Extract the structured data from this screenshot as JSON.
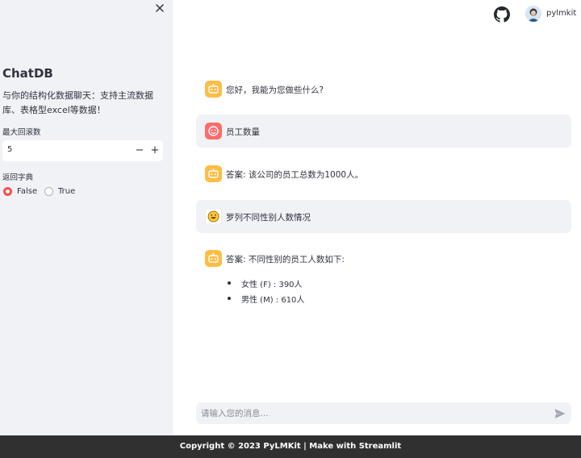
{
  "sidebar": {
    "title": "ChatDB",
    "description": "与你的结构化数据聊天：支持主流数据库、表格型excel等数据！",
    "max_rounds_label": "最大回滚数",
    "max_rounds_value": "5",
    "decrement": "−",
    "increment": "+",
    "return_dict_label": "返回字典",
    "radio_false": "False",
    "radio_true": "True"
  },
  "header": {
    "username": "pylmkit"
  },
  "messages": [
    {
      "role": "assistant",
      "text": "您好，我能为您做些什么?"
    },
    {
      "role": "user",
      "text": "员工数量"
    },
    {
      "role": "assistant",
      "text": "答案: 该公司的员工总数为1000人。"
    },
    {
      "role": "user",
      "text": "罗列不同性别人数情况"
    },
    {
      "role": "assistant",
      "text": "答案: 不同性别的员工人数如下:",
      "list": [
        "女性 (F) : 390人",
        "男性 (M) : 610人"
      ]
    }
  ],
  "chat_input": {
    "placeholder": "请输入您的消息..."
  },
  "footer": {
    "text": "Copyright © 2023 PyLMKit | Make with Streamlit"
  },
  "colors": {
    "accent": "#ff4b4b",
    "bot_icon": "#ffbd45",
    "user_icon": "#ff6c6c",
    "sidebar_bg": "#f0f2f6",
    "footer_bg": "#303030"
  }
}
